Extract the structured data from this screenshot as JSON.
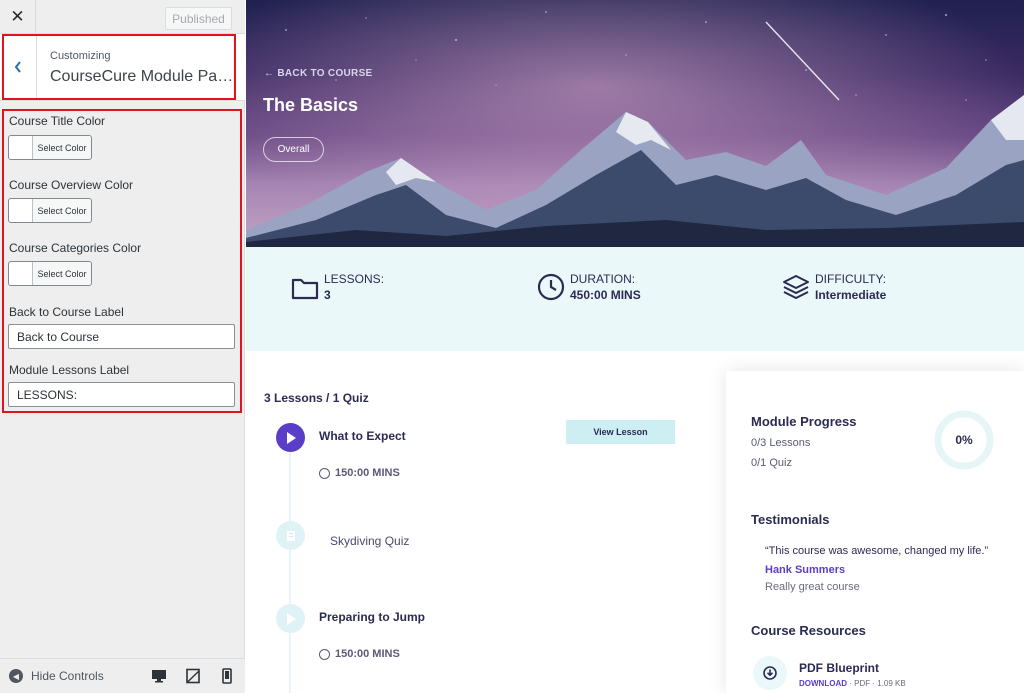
{
  "customizer": {
    "close_label": "✕",
    "published_label": "Published",
    "customizing_label": "Customizing",
    "section_title": "CourseCure Module Page Settings",
    "controls": {
      "course_title_color": {
        "label": "Course Title Color",
        "button": "Select Color"
      },
      "course_overview_color": {
        "label": "Course Overview Color",
        "button": "Select Color"
      },
      "course_categories_color": {
        "label": "Course Categories Color",
        "button": "Select Color"
      },
      "back_to_course_label": {
        "label": "Back to Course Label",
        "value": "Back to Course"
      },
      "module_lessons_label": {
        "label": "Module Lessons Label",
        "value": "LESSONS:"
      }
    },
    "hide_controls_label": "Hide Controls",
    "highlight_color": "#e0141e"
  },
  "preview": {
    "back_link": "← BACK TO COURSE",
    "module_title": "The Basics",
    "overall_pill": "Overall",
    "stats": {
      "lessons": {
        "label": "LESSONS:",
        "value": "3"
      },
      "duration": {
        "label": "DURATION:",
        "value": "450:00 MINS"
      },
      "difficulty": {
        "label": "DIFFICULTY:",
        "value": "Intermediate"
      }
    },
    "lessons_count": "3 Lessons / 1 Quiz",
    "lessons": [
      {
        "title": "What to Expect",
        "duration": "150:00 MINS",
        "state": "active"
      },
      {
        "title": "Skydiving Quiz",
        "type": "quiz"
      },
      {
        "title": "Preparing to Jump",
        "duration": "150:00 MINS",
        "state": "upcoming"
      }
    ],
    "view_lesson_label": "View Lesson",
    "progress": {
      "heading": "Module Progress",
      "lessons": "0/3 Lessons",
      "quiz": "0/1 Quiz",
      "percent_label": "0%",
      "percent": 0
    },
    "testimonials": {
      "heading": "Testimonials",
      "quote": "“This course was awesome, changed my life.”",
      "author": "Hank Summers",
      "role": "Really great course"
    },
    "resources": {
      "heading": "Course Resources",
      "item_name": "PDF Blueprint",
      "download_label": "DOWNLOAD",
      "meta": " · PDF · 1.09 KB"
    },
    "colors": {
      "accent": "#5a3ec8",
      "band": "#eaf8f9",
      "navy": "#2b2b52"
    }
  }
}
